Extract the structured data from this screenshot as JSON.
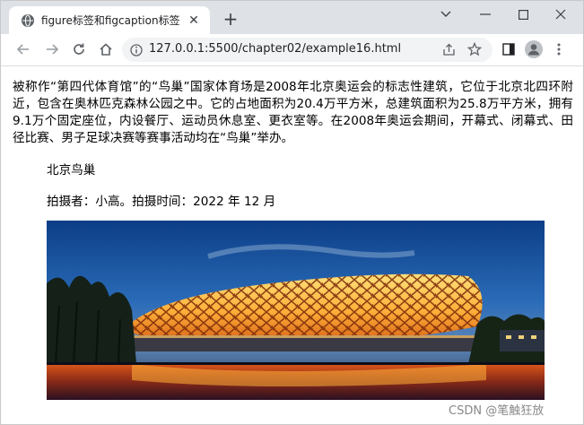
{
  "browser": {
    "tab_title": "figure标签和figcaption标签",
    "tab_close_glyph": "✕",
    "new_tab_glyph": "+",
    "url": "127.0.0.1:5500/chapter02/example16.html"
  },
  "page": {
    "paragraph": "被称作“第四代体育馆”的“鸟巢”国家体育场是2008年北京奥运会的标志性建筑，它位于北京北四环附近，包含在奥林匹克森林公园之中。它的占地面积为20.4万平方米，总建筑面积为25.8万平方米，拥有9.1万个固定座位，内设餐厅、运动员休息室、更衣室等。在2008年奥运会期间，开幕式、闭幕式、田径比赛、男子足球决赛等赛事活动均在“鸟巢”举办。",
    "figure_caption": "北京鸟巢",
    "figure_meta": "拍摄者：小高。拍摄时间：2022 年 12 月"
  },
  "watermark": "CSDN @笔触狂放",
  "colors": {
    "tabstrip": "#dee1e6",
    "omnibox": "#f1f3f4",
    "icon": "#5f6368"
  }
}
